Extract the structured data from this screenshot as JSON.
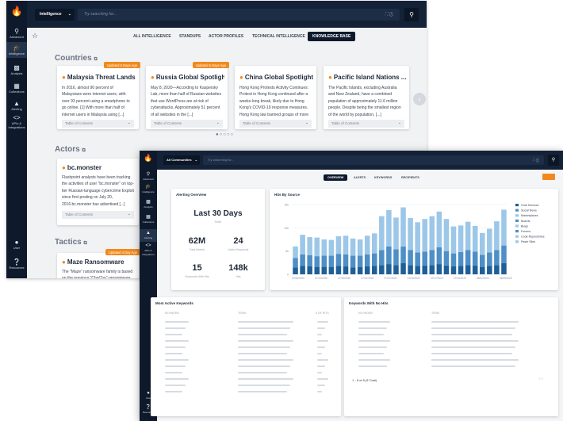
{
  "window1": {
    "sidebar": {
      "items": [
        {
          "label": "Advanced",
          "icon": "search-icon"
        },
        {
          "label": "Intelligence",
          "icon": "graduation-cap-icon"
        },
        {
          "label": "Analysis",
          "icon": "chart-icon"
        },
        {
          "label": "Collections",
          "icon": "columns-icon"
        },
        {
          "label": "Alerting",
          "icon": "bell-icon"
        },
        {
          "label": "APIs & Integrations",
          "icon": "code-icon"
        },
        {
          "label": "User",
          "icon": "user-icon"
        },
        {
          "label": "Resources",
          "icon": "help-icon"
        }
      ]
    },
    "topbar": {
      "selector": "Intelligence",
      "placeholder": "Try searching for..."
    },
    "nav": {
      "tabs": [
        "ALL INTELLIGENCE",
        "STANDUPS",
        "ACTOR PROFILES",
        "TECHNICAL INTELLIGENCE",
        "KNOWLEDGE BASE"
      ],
      "active": "KNOWLEDGE BASE"
    },
    "countries": {
      "heading": "Countries",
      "cards": [
        {
          "badge": "Updated 5 Days Ago",
          "title": "Malaysia Threat Lands...",
          "body": "In 2016, almost 90 percent of Malaysians were internet users, with over 93 percent using a smartphone to go online. [1] With more than half of internet users in Malaysia using [...]",
          "toc": "Table of Contents"
        },
        {
          "badge": "Updated 5 Days Ago",
          "title": "Russia Global Spotlight",
          "body": "May 8, 2020—According to Kaspersky Lab, more than half of Russian websites that use WordPress are at risk of cyberattacks. Approximately 51 percent of all websites in the [...]",
          "toc": "Table of Contents"
        },
        {
          "badge": "",
          "title": "China Global Spotlight",
          "body": "Hong Kong Protests Activity Continues: Protest in Hong Kong continued after a weeks-long break, likely due to Hong Kong's COVID-19 response measures. Hong Kong law banned groups of more [...]",
          "toc": "Table of Contents"
        },
        {
          "badge": "",
          "title": "Pacific Island Nations ...",
          "body": "The Pacific Islands, excluding Australia and New Zealand, have a combined population of approximately 11.6 million people. Despite being the smallest region of the world by population, [...]",
          "toc": "Table of Contents"
        }
      ]
    },
    "actors": {
      "heading": "Actors",
      "card": {
        "title": "bc.monster",
        "body": "Flashpoint analysts have been tracking the activities of user \"bc.monster\" on top-tier Russian-language cybercrime Exploit since first posting on July 20, 2016.bc.monster has advertised [...]",
        "toc": "Table of Contents"
      }
    },
    "tactics": {
      "heading": "Tactics",
      "card": {
        "badge": "Updated 4 Day Ago",
        "title": "Maze Ransomware",
        "body": "The \"Maze\" ransomware family is based on the previous \"ChaCha\" ransomware. It"
      }
    }
  },
  "window2": {
    "sidebar": {
      "items": [
        {
          "label": "Advanced",
          "icon": "search-icon"
        },
        {
          "label": "Intelligence",
          "icon": "graduation-cap-icon"
        },
        {
          "label": "Analysis",
          "icon": "chart-icon"
        },
        {
          "label": "Collections",
          "icon": "columns-icon"
        },
        {
          "label": "Alerting",
          "icon": "bell-icon"
        },
        {
          "label": "APIs & Integrations",
          "icon": "code-icon"
        },
        {
          "label": "User",
          "icon": "user-icon"
        },
        {
          "label": "Resources",
          "icon": "help-icon"
        }
      ]
    },
    "topbar": {
      "selector": "All Communities",
      "placeholder": "Try searching for..."
    },
    "nav": {
      "tabs": [
        "OVERVIEW",
        "ALERTS",
        "KEYWORDS",
        "RECIPIENTS"
      ],
      "active": "OVERVIEW"
    },
    "alerting": {
      "title": "Alerting Overview",
      "period": "Last 30 Days",
      "sub": "Since",
      "stats": [
        {
          "value": "62M",
          "label": "Total Alerted"
        },
        {
          "value": "24",
          "label": "Active Keywords"
        },
        {
          "value": "15",
          "label": "Keywords With Hits"
        },
        {
          "value": "148k",
          "label": "Hits"
        }
      ]
    },
    "hits_title": "Hits By Source",
    "keywords_title": "Most Active Keywords",
    "keywords_cols": [
      "KEYWORD",
      "TERM",
      "# OF HITS"
    ],
    "nohits_title": "Keywords With No Hits",
    "nohits_cols": [
      "KEYWORD",
      "TERM"
    ],
    "nohits_footer": "1 - 8 of 8 (8 Total)",
    "colors": {
      "dark": "#1f5f96",
      "mid": "#4d8fc6",
      "light": "#9cc7e8",
      "accent": "#f08a1e"
    }
  },
  "chart_data": {
    "type": "bar",
    "title": "Hits By Source",
    "ylim": [
      0,
      15
    ],
    "yticks": [
      "0",
      "5k",
      "10k",
      "15k"
    ],
    "x_ticks": [
      "07/05/2020",
      "07/12/2020",
      "07/19/2020",
      "07/21/2020",
      "07/27/2020",
      "07/24/2020",
      "07/17/2020",
      "07/30/2020",
      "08/02/2020",
      "08/09/2020"
    ],
    "legend": [
      "Chat Services",
      "Social News",
      "Marketplaces",
      "Boards",
      "Blogs",
      "Forums",
      "Code Repositories",
      "Paste Sites"
    ],
    "series": [
      {
        "name": "Chat Services",
        "values": [
          1.5,
          1.8,
          1.7,
          1.6,
          1.6,
          1.6,
          1.8,
          1.7,
          1.5,
          1.6,
          1.7,
          1.8,
          2.0,
          2.2,
          2.0,
          2.4,
          2.0,
          1.8,
          1.9,
          2.0,
          2.2,
          1.9,
          1.7,
          1.8,
          2.0,
          1.9,
          1.6,
          1.8,
          2.0,
          2.4
        ]
      },
      {
        "name": "Social News",
        "values": [
          2.0,
          2.5,
          2.4,
          2.3,
          2.4,
          2.4,
          2.6,
          2.6,
          2.5,
          2.4,
          2.6,
          2.7,
          3.2,
          3.8,
          3.4,
          3.6,
          3.2,
          2.9,
          3.0,
          3.2,
          3.6,
          3.1,
          2.8,
          3.0,
          3.2,
          3.0,
          2.6,
          2.9,
          3.2,
          3.8
        ]
      },
      {
        "name": "Forums",
        "values": [
          2.5,
          4.2,
          3.9,
          4.0,
          3.5,
          3.4,
          3.8,
          4.0,
          3.7,
          3.5,
          4.0,
          4.3,
          7.3,
          7.8,
          6.8,
          8.4,
          6.9,
          6.5,
          7.0,
          7.3,
          7.7,
          6.9,
          5.8,
          5.7,
          6.1,
          5.5,
          4.7,
          5.1,
          6.2,
          7.7
        ]
      }
    ]
  }
}
